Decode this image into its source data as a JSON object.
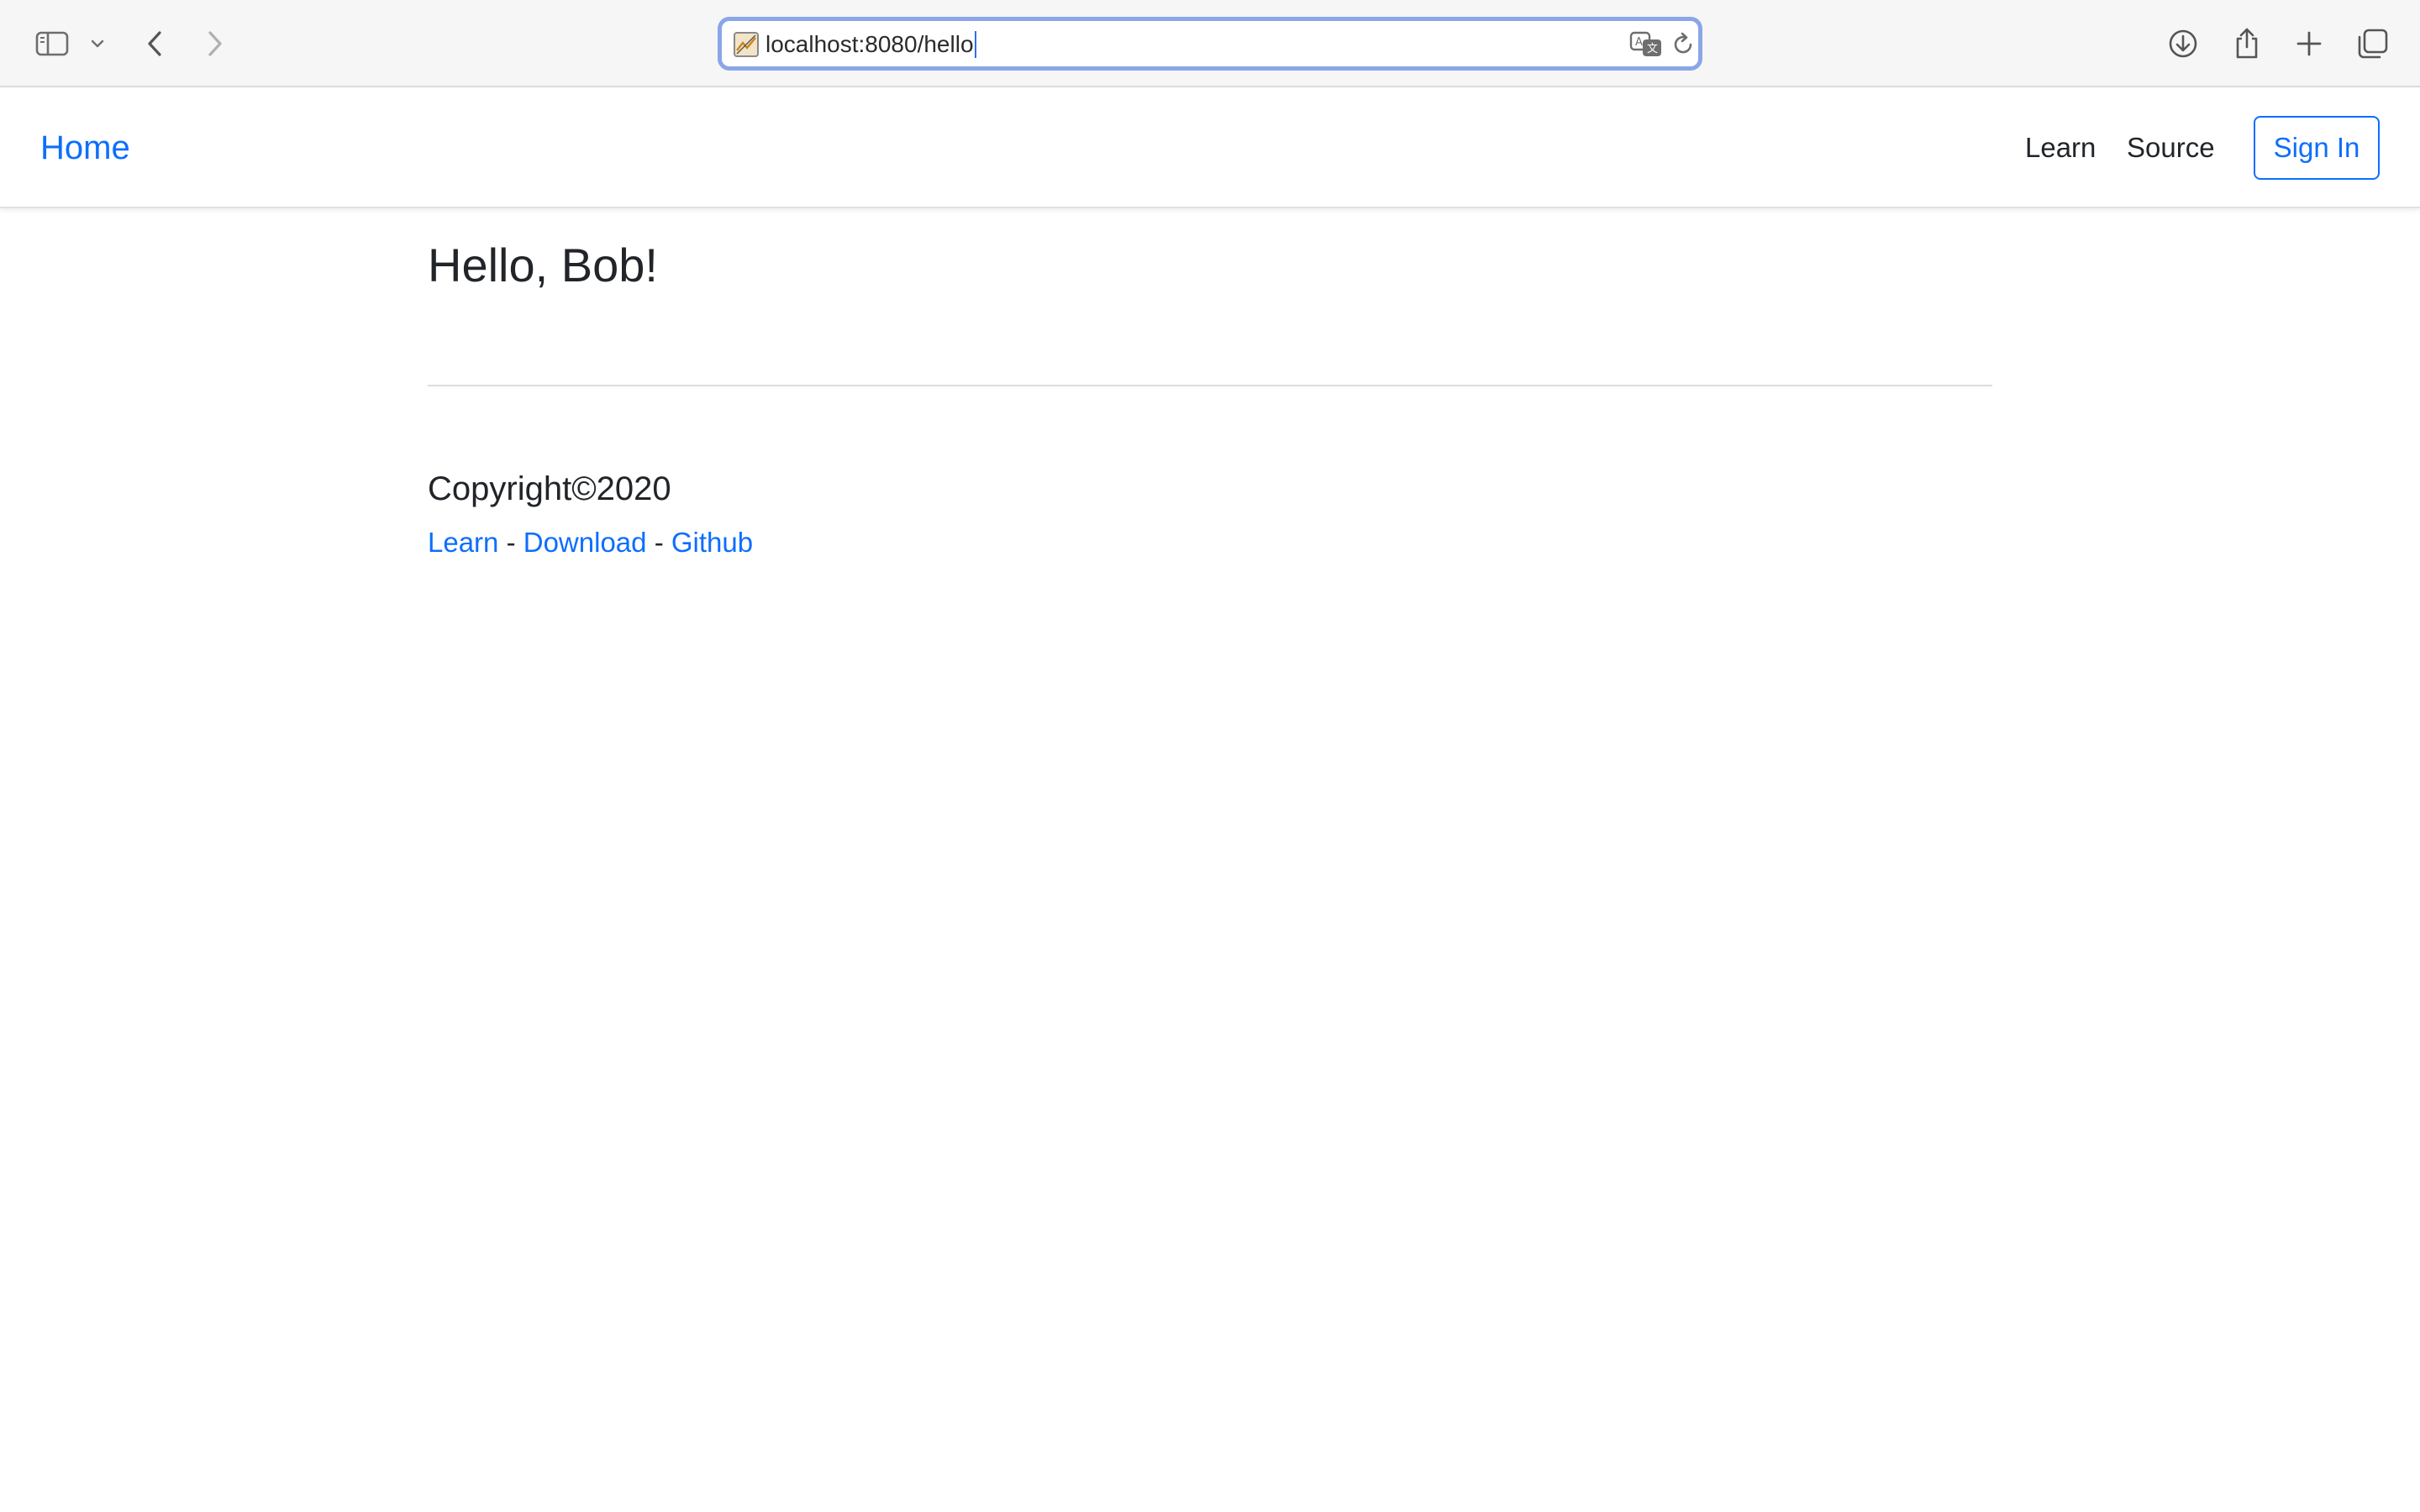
{
  "browser": {
    "url": "localhost:8080/hello",
    "icons": {
      "sidebar": "sidebar-icon",
      "sidebar_menu": "chevron-down-icon",
      "back": "back-arrow-icon",
      "forward": "forward-arrow-icon",
      "translate": "translate-icon",
      "reload": "reload-icon",
      "downloads": "download-icon",
      "share": "share-icon",
      "new_tab": "plus-icon",
      "tabs_overview": "tabs-icon"
    }
  },
  "navbar": {
    "brand": "Home",
    "links": [
      "Learn",
      "Source"
    ],
    "sign_in": "Sign In"
  },
  "content": {
    "greeting": "Hello, Bob!"
  },
  "footer": {
    "copyright": "Copyright©2020",
    "links": [
      "Learn",
      "Download",
      "Github"
    ],
    "separator": "-"
  },
  "colors": {
    "link": "#0d6efd",
    "text": "#212529",
    "url_focus_ring": "#8aa6e8"
  }
}
